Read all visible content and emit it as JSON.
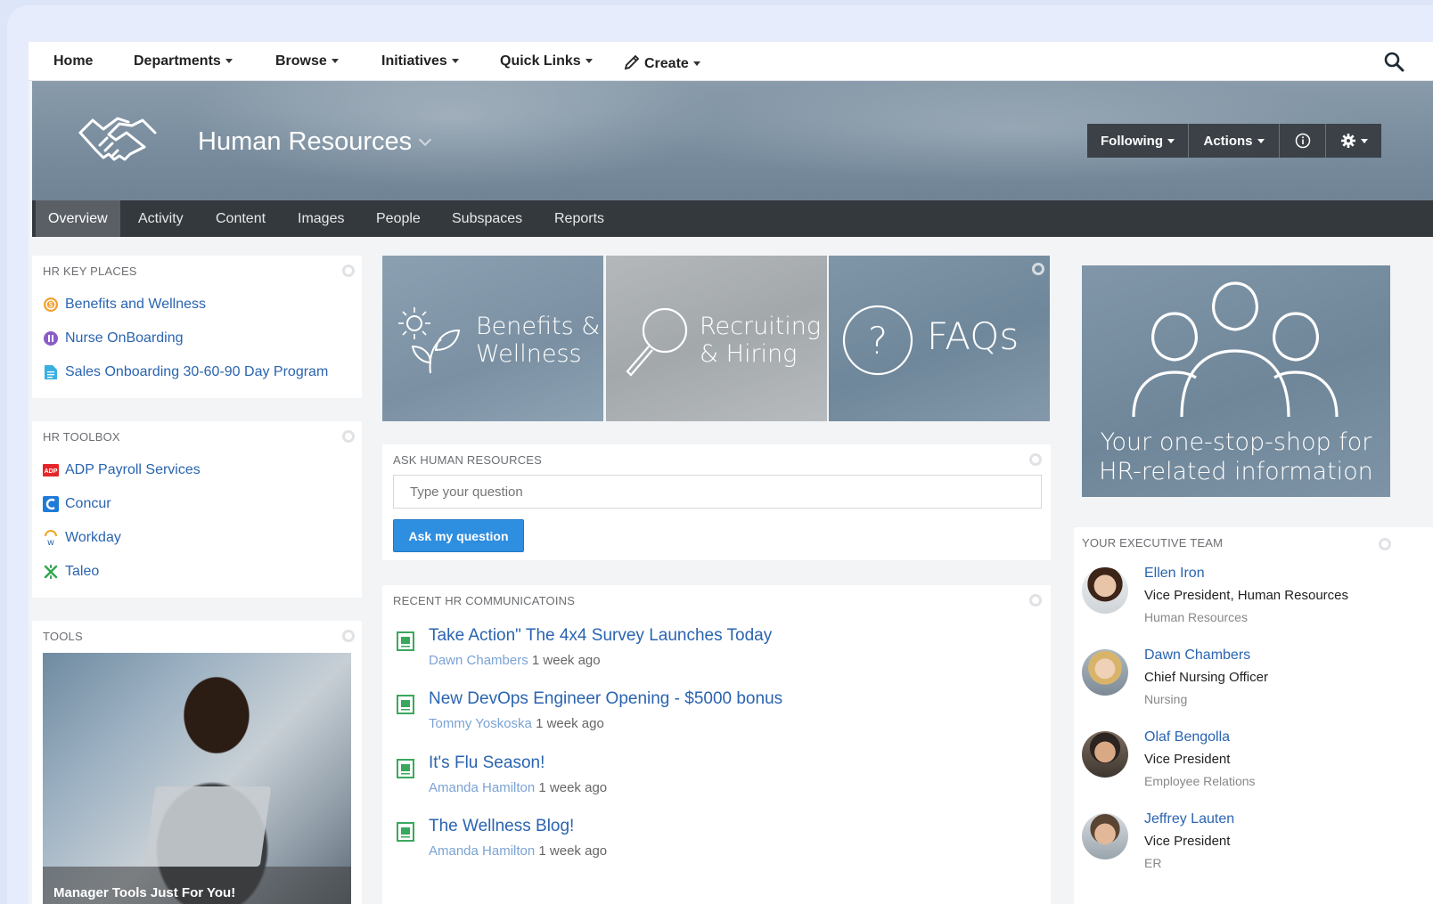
{
  "topnav": {
    "items": [
      {
        "label": "Home",
        "has_caret": false
      },
      {
        "label": "Departments",
        "has_caret": true
      },
      {
        "label": "Browse",
        "has_caret": true
      },
      {
        "label": "Initiatives",
        "has_caret": true
      },
      {
        "label": "Quick Links",
        "has_caret": true
      },
      {
        "label": "Create",
        "has_caret": true,
        "icon": "pencil-icon"
      }
    ],
    "search_icon": "search-icon"
  },
  "banner": {
    "title": "Human Resources",
    "logo_icon": "handshake-icon",
    "buttons": {
      "following": "Following",
      "actions": "Actions",
      "info_icon": "info-icon",
      "settings_icon": "gear-icon"
    }
  },
  "subnav": {
    "tabs": [
      "Overview",
      "Activity",
      "Content",
      "Images",
      "People",
      "Subspaces",
      "Reports"
    ],
    "active": "Overview"
  },
  "key_places": {
    "title": "HR KEY PLACES",
    "items": [
      {
        "label": "Benefits and Wellness",
        "icon": "benefits-icon",
        "color": "#f0a030"
      },
      {
        "label": "Nurse OnBoarding",
        "icon": "nurse-icon",
        "color": "#8a5cc7"
      },
      {
        "label": "Sales Onboarding 30-60-90 Day Program",
        "icon": "document-icon",
        "color": "#3ab0e0"
      }
    ]
  },
  "toolbox": {
    "title": "HR TOOLBOX",
    "items": [
      {
        "label": "ADP Payroll Services",
        "icon": "adp-icon",
        "color": "#e4262a"
      },
      {
        "label": "Concur",
        "icon": "concur-icon",
        "color": "#1f7ad8"
      },
      {
        "label": "Workday",
        "icon": "workday-icon",
        "color": "#f1a627"
      },
      {
        "label": "Taleo",
        "icon": "taleo-icon",
        "color": "#2aa84a"
      }
    ]
  },
  "tools": {
    "title": "TOOLS",
    "caption": "Manager Tools Just For You!"
  },
  "tiles": [
    {
      "line1": "Benefits &",
      "line2": "Wellness",
      "icon": "flower-icon"
    },
    {
      "line1": "Recruiting",
      "line2": "& Hiring",
      "icon": "magnifier-icon"
    },
    {
      "line1": "FAQs",
      "line2": "",
      "icon": "question-icon"
    }
  ],
  "ask": {
    "title": "ASK HUMAN RESOURCES",
    "placeholder": "Type your question",
    "button": "Ask my question"
  },
  "communications": {
    "title": "RECENT HR COMMUNICATOINS",
    "items": [
      {
        "title": "Take Action\" The 4x4 Survey Launches Today",
        "author": "Dawn Chambers",
        "time": "1 week ago"
      },
      {
        "title": "New DevOps Engineer Opening - $5000 bonus",
        "author": "Tommy Yoskoska",
        "time": "1 week ago"
      },
      {
        "title": "It's Flu Season!",
        "author": "Amanda Hamilton",
        "time": "1 week ago"
      },
      {
        "title": "The Wellness Blog!",
        "author": "Amanda Hamilton",
        "time": "1 week ago"
      }
    ]
  },
  "promo": {
    "line1": "Your one-stop-shop for",
    "line2": "HR-related information",
    "icon": "people-group-icon"
  },
  "exec_team": {
    "title": "YOUR EXECUTIVE TEAM",
    "members": [
      {
        "name": "Ellen Iron",
        "title": "Vice President, Human Resources",
        "dept": "Human Resources"
      },
      {
        "name": "Dawn Chambers",
        "title": "Chief Nursing Officer",
        "dept": "Nursing"
      },
      {
        "name": "Olaf Bengolla",
        "title": "Vice President",
        "dept": "Employee Relations"
      },
      {
        "name": "Jeffrey Lauten",
        "title": "Vice President",
        "dept": "ER"
      }
    ]
  }
}
